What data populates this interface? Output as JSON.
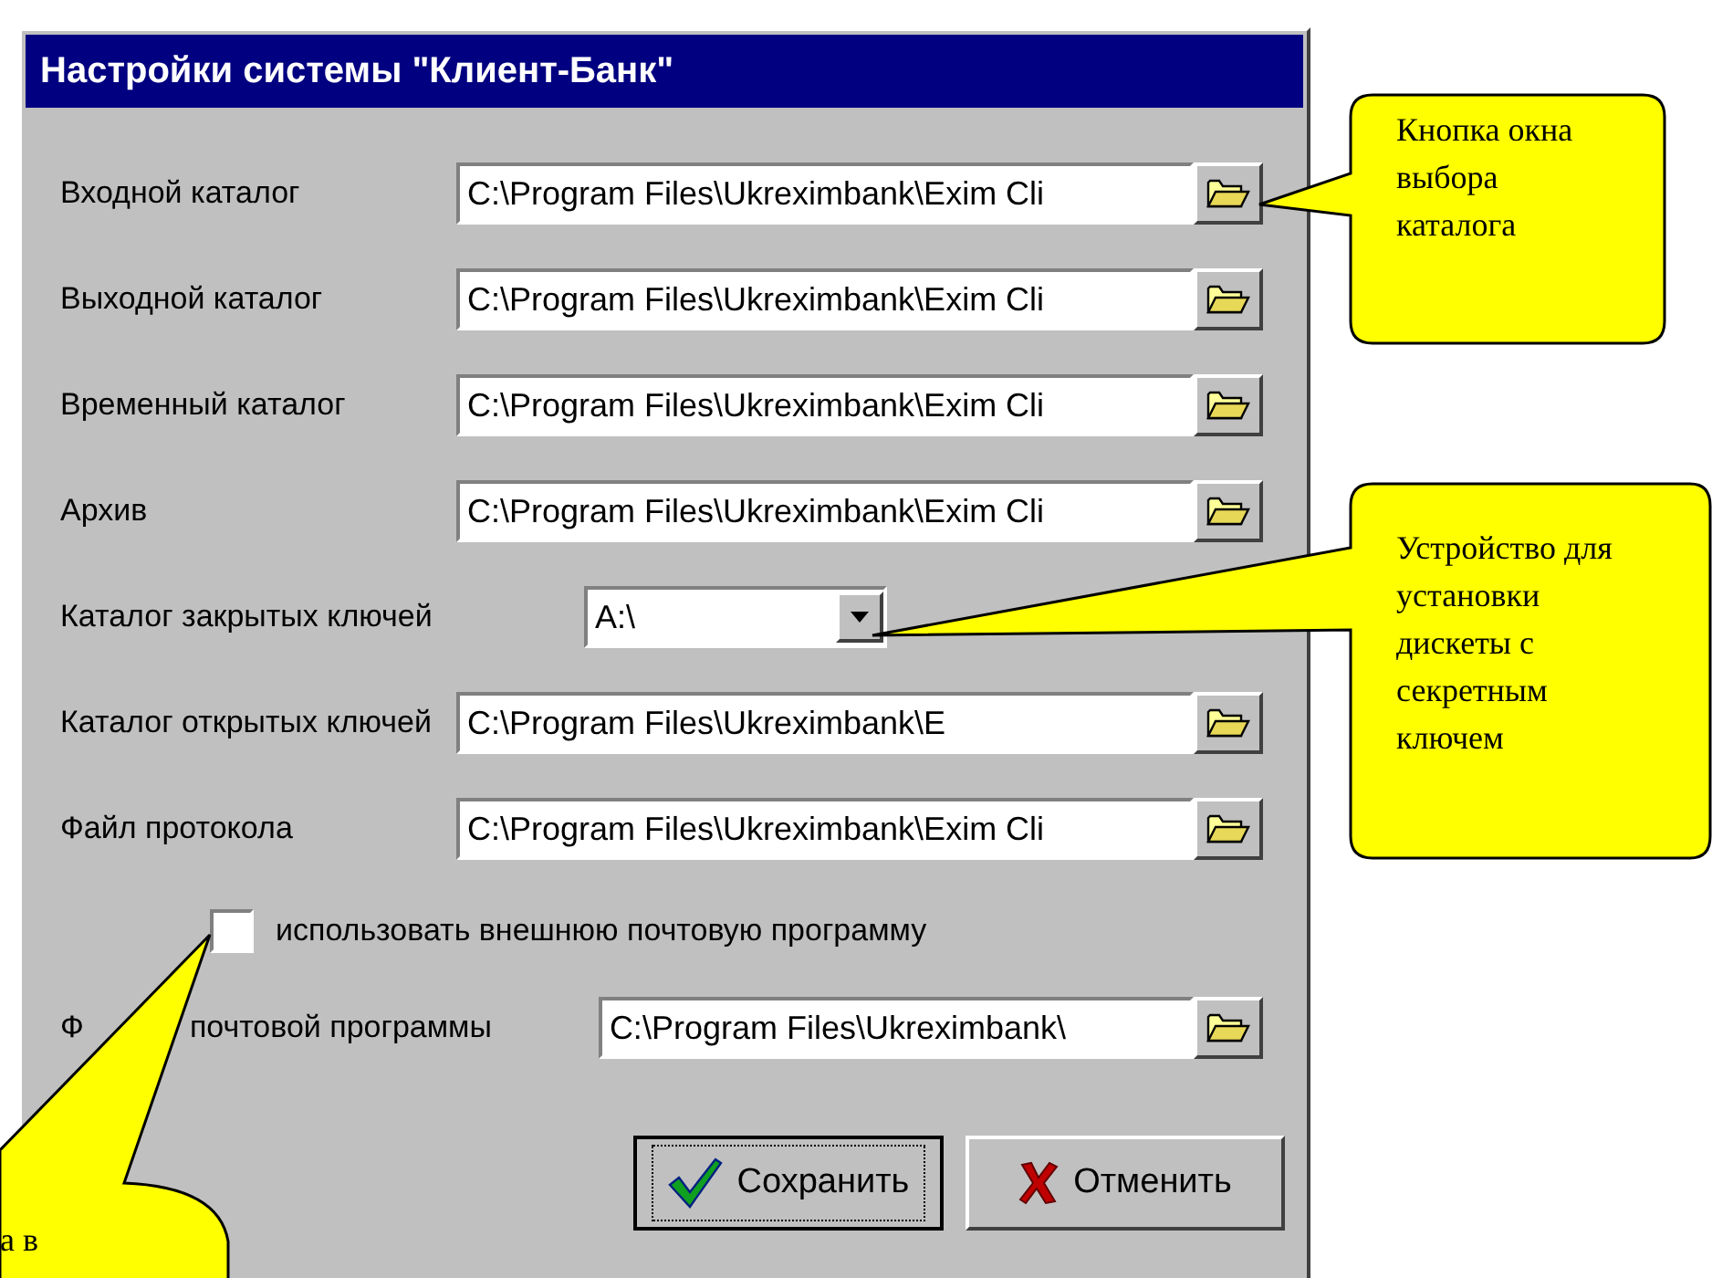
{
  "window": {
    "title": "Настройки системы \"Клиент-Банк\""
  },
  "rows": [
    {
      "kind": "path",
      "label": "Входной каталог",
      "value": "C:\\Program Files\\Ukreximbank\\Exim Cli"
    },
    {
      "kind": "path",
      "label": "Выходной каталог",
      "value": "C:\\Program Files\\Ukreximbank\\Exim Cli"
    },
    {
      "kind": "path",
      "label": "Временный каталог",
      "value": "C:\\Program Files\\Ukreximbank\\Exim Cli"
    },
    {
      "kind": "path",
      "label": "Архив",
      "value": "C:\\Program Files\\Ukreximbank\\Exim Cli"
    },
    {
      "kind": "dropdown",
      "label": "Каталог закрытых ключей",
      "value": "A:\\"
    },
    {
      "kind": "path",
      "label": "Каталог открытых ключей",
      "value": "C:\\Program Files\\Ukreximbank\\E"
    },
    {
      "kind": "path",
      "label": "Файл протокола",
      "value": "C:\\Program Files\\Ukreximbank\\Exim Cli"
    }
  ],
  "mail_checkbox": {
    "label": "использовать внешнюю почтовую программу",
    "checked": false
  },
  "mail_row": {
    "label_parts": [
      "Ф",
      "почтовой программы"
    ],
    "value": "C:\\Program Files\\Ukreximbank\\"
  },
  "buttons": [
    {
      "kind": "save",
      "label": "Сохранить",
      "focused": true
    },
    {
      "kind": "cancel",
      "label": "Отменить",
      "focused": false
    }
  ],
  "callouts": [
    {
      "text": "Кнопка окна выбора каталога"
    },
    {
      "text": "Устройство для установки дискеты с секретным ключем"
    },
    {
      "text": "а в"
    }
  ]
}
